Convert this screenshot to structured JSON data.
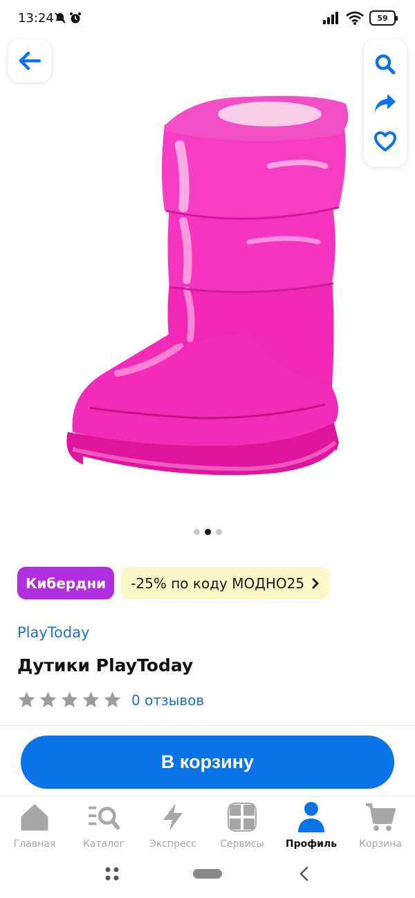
{
  "status_bar": {
    "time": "13:24",
    "battery": "59"
  },
  "top_actions": {
    "back_icon": "arrow-left-icon",
    "search_icon": "search-icon",
    "share_icon": "share-icon",
    "favorite_icon": "heart-icon"
  },
  "gallery": {
    "image_alt": "pink-puffer-boot",
    "dots_total": 3,
    "active_dot": 2
  },
  "promo": {
    "badge_label": "Кибердни",
    "code_text": "-25% по коду МОДНО25"
  },
  "product": {
    "brand": "PlayToday",
    "title": "Дутики PlayToday",
    "rating": 0,
    "reviews_label": "0 отзывов"
  },
  "cart_button_label": "В корзину",
  "bottom_nav": {
    "items": [
      {
        "label": "Главная",
        "icon": "home-icon"
      },
      {
        "label": "Каталог",
        "icon": "catalog-search-icon"
      },
      {
        "label": "Экспресс",
        "icon": "lightning-icon"
      },
      {
        "label": "Сервисы",
        "icon": "services-grid-icon"
      },
      {
        "label": "Профиль",
        "icon": "profile-icon"
      },
      {
        "label": "Корзина",
        "icon": "cart-icon"
      }
    ],
    "active_label": "Профиль"
  },
  "colors": {
    "accent": "#0a73e8",
    "link": "#1b6fd6",
    "cyber_badge": "#b12ee0",
    "promo_bg": "#fdf6c7",
    "product_pink": "#f01fb4"
  }
}
